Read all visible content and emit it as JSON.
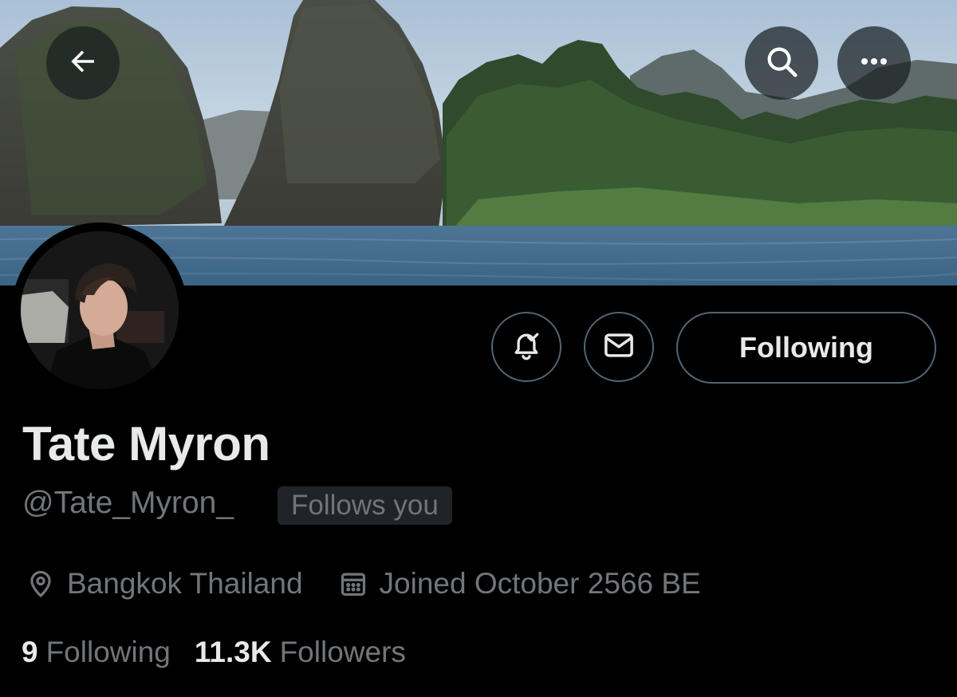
{
  "header": {
    "back_icon": "arrow-left-icon",
    "search_icon": "search-icon",
    "more_icon": "more-horizontal-icon"
  },
  "profile": {
    "display_name": "Tate Myron",
    "handle": "@Tate_Myron_",
    "follows_you_badge": "Follows you",
    "location": "Bangkok Thailand",
    "joined": "Joined October 2566 BE",
    "following_count": "9",
    "following_label": "Following",
    "followers_count": "11.3K",
    "followers_label": "Followers"
  },
  "actions": {
    "notify_icon": "bell-check-icon",
    "message_icon": "envelope-icon",
    "follow_button_label": "Following"
  },
  "colors": {
    "background": "#000000",
    "primary_text": "#e7e9ea",
    "secondary_text": "#71767b",
    "border": "#536471",
    "badge_bg": "#202327"
  }
}
